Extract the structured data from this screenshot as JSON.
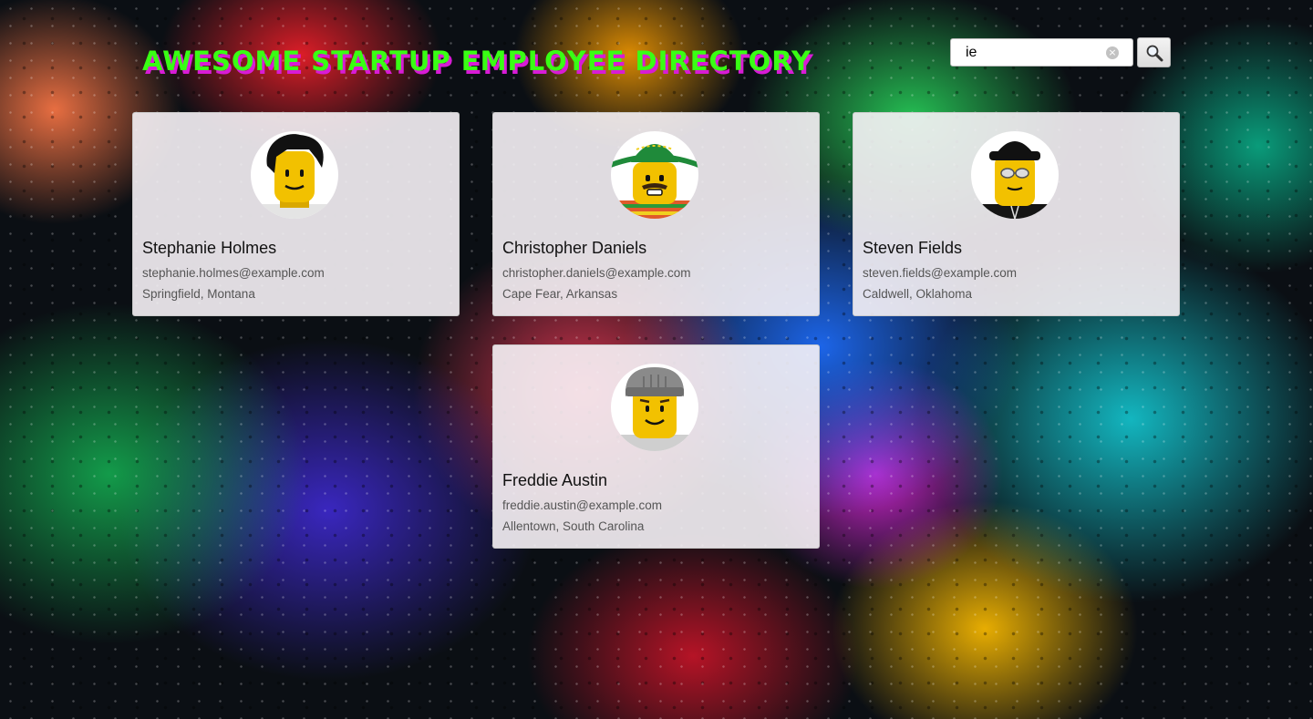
{
  "header": {
    "title": "AWESOME STARTUP EMPLOYEE DIRECTORY"
  },
  "search": {
    "value": "ie",
    "clear_icon": "clear-circle-icon",
    "button_icon": "search-icon"
  },
  "employees": [
    {
      "name": "Stephanie Holmes",
      "email": "stephanie.holmes@example.com",
      "location": "Springfield, Montana",
      "avatar": "lego-minifigure-black-hair"
    },
    {
      "name": "Christopher Daniels",
      "email": "christopher.daniels@example.com",
      "location": "Cape Fear, Arkansas",
      "avatar": "lego-minifigure-sombrero"
    },
    {
      "name": "Steven Fields",
      "email": "steven.fields@example.com",
      "location": "Caldwell, Oklahoma",
      "avatar": "lego-minifigure-black-cap-glasses"
    },
    {
      "name": "Freddie Austin",
      "email": "freddie.austin@example.com",
      "location": "Allentown, South Carolina",
      "avatar": "lego-minifigure-grey-beanie"
    }
  ],
  "colors": {
    "title": "#39ff14",
    "title_shadow": "#d81bd6",
    "card_background": "#f6f2f6"
  }
}
